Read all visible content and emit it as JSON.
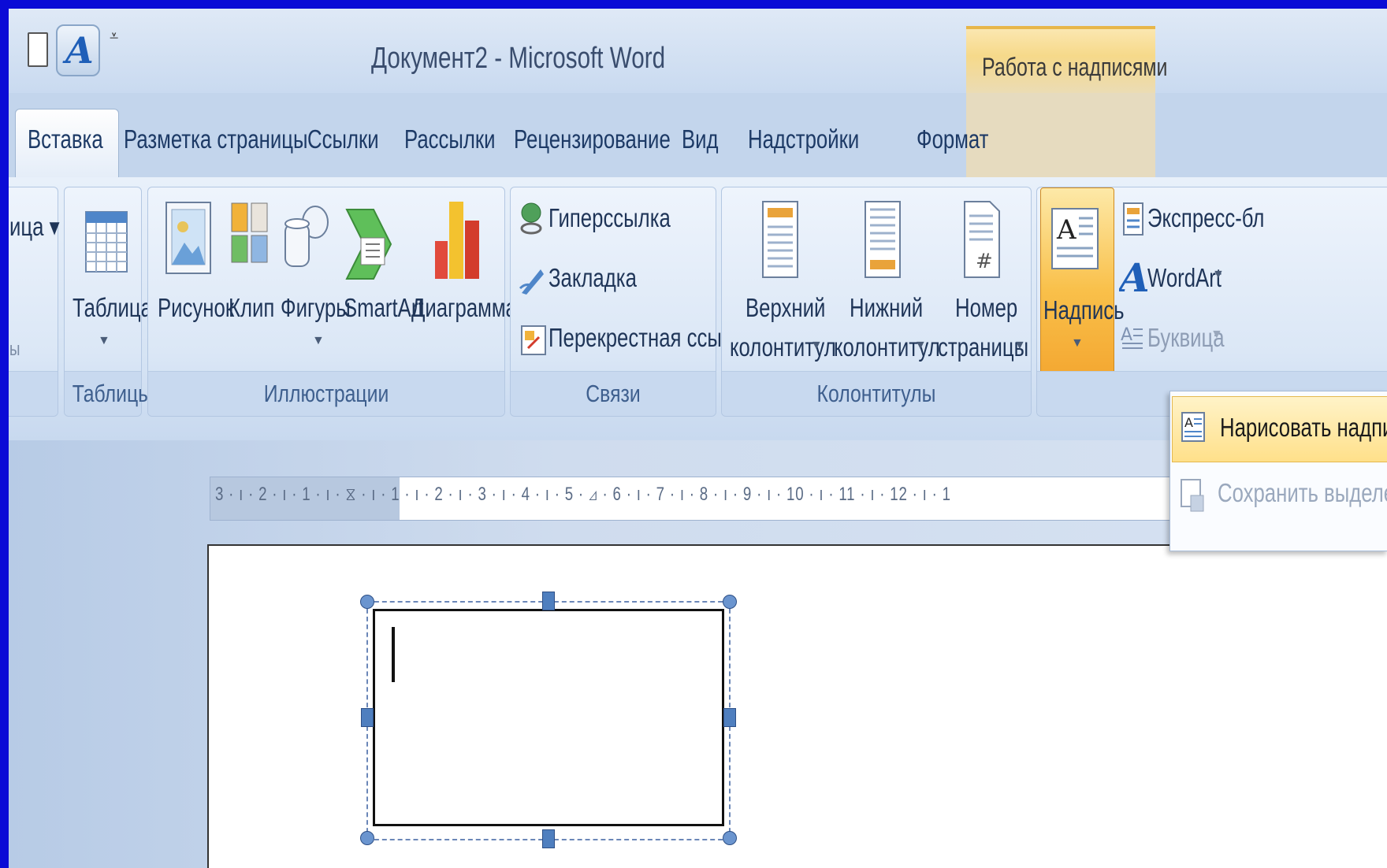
{
  "window": {
    "title": "Документ2 - Microsoft Word",
    "context_group": "Работа с надписями"
  },
  "tabs": [
    {
      "label": "Вставка",
      "active": true
    },
    {
      "label": "Разметка страницы"
    },
    {
      "label": "Ссылки"
    },
    {
      "label": "Рассылки"
    },
    {
      "label": "Рецензирование"
    },
    {
      "label": "Вид"
    },
    {
      "label": "Надстройки"
    },
    {
      "label": "Формат"
    }
  ],
  "ribbon": {
    "partial_left": {
      "label_top": "ица ▾",
      "label_bottom": "ы"
    },
    "tables": {
      "group": "Таблицы",
      "table_button": "Таблица"
    },
    "illustrations": {
      "group": "Иллюстрации",
      "picture": "Рисунок",
      "clip": "Клип",
      "shapes": "Фигуры",
      "smartart": "SmartArt",
      "chart": "Диаграмма"
    },
    "links": {
      "group": "Связи",
      "hyperlink": "Гиперссылка",
      "bookmark": "Закладка",
      "cross_reference": "Перекрестная ссылка"
    },
    "header_footer": {
      "group": "Колонтитулы",
      "header_line1": "Верхний",
      "header_line2": "колонтитул",
      "footer_line1": "Нижний",
      "footer_line2": "колонтитул",
      "pagenum_line1": "Номер",
      "pagenum_line2": "страницы"
    },
    "text": {
      "textbox": "Надпись",
      "quick_parts": "Экспресс-бл",
      "wordart": "WordArt",
      "dropcap": "Буквица"
    }
  },
  "ruler": {
    "ticks": "3 · ı · 2 · ı · 1 · ı · ⧖ · ı · 1 · ı · 2 · ı · 3 · ı · 4 · ı · 5 · ⊿ · 6 · ı · 7 · ı · 8 · ı · 9 · ı · 10 · ı · 11 · ı · 12 · ı · 1"
  },
  "dropdown": {
    "draw_textbox": "Нарисовать надпис",
    "save_selection": "Сохранить выделен"
  },
  "colors": {
    "frame": "#0b0bd6",
    "accent_orange": "#f6c24a",
    "ribbon_text": "#1f3558"
  }
}
